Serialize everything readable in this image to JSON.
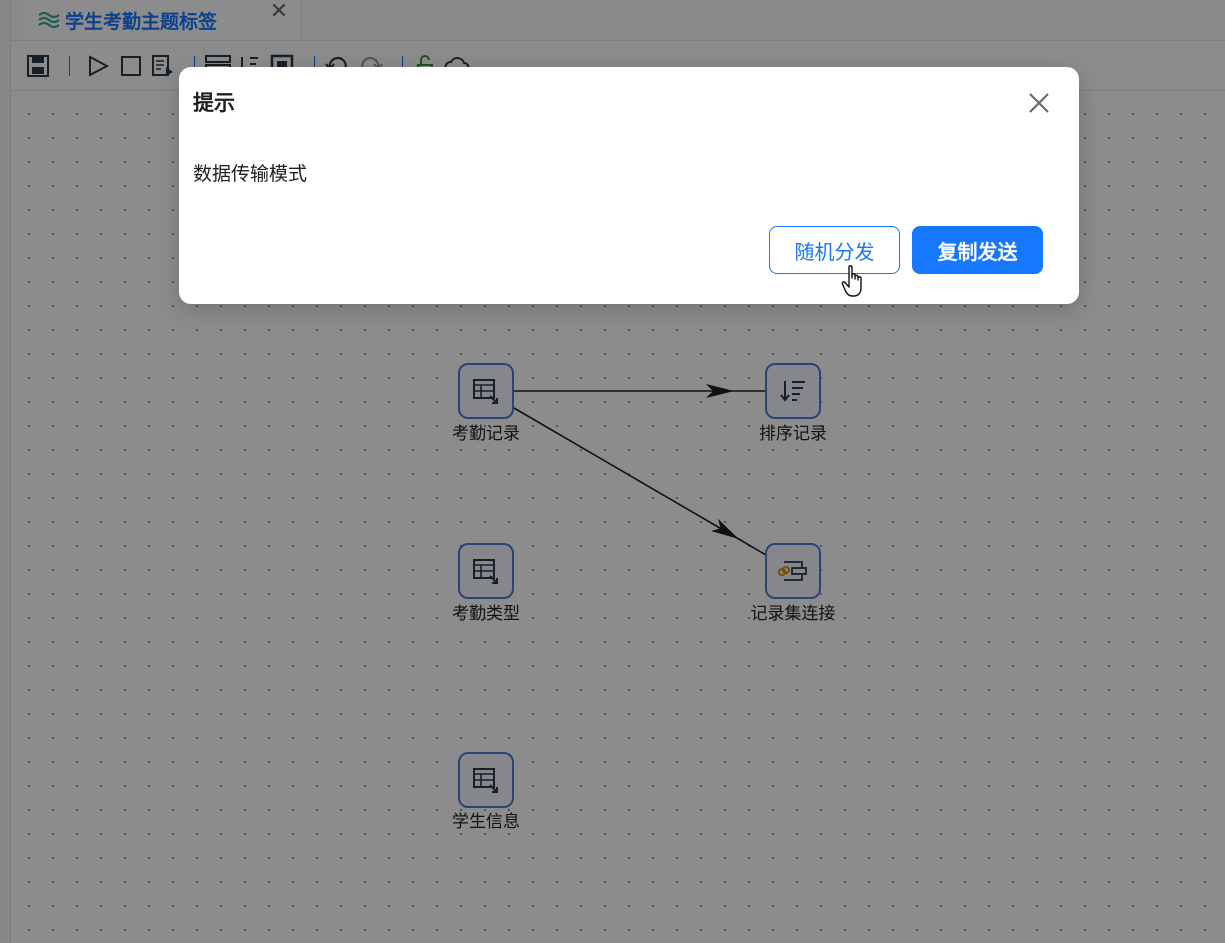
{
  "tab": {
    "title": "学生考勤主题标签",
    "close": "✕"
  },
  "toolbar": {
    "buttons": [
      "save-icon",
      "run-icon",
      "stop-icon",
      "preview-icon",
      "layout-icon",
      "align-icon",
      "grid-icon",
      "undo-icon",
      "redo-icon",
      "unlock-icon",
      "cloud-icon"
    ]
  },
  "nodes": [
    {
      "id": "attendance-records",
      "label": "考勤记录",
      "icon": "table-input-icon"
    },
    {
      "id": "sorted-records",
      "label": "排序记录",
      "icon": "sort-icon"
    },
    {
      "id": "attendance-types",
      "label": "考勤类型",
      "icon": "table-input-icon"
    },
    {
      "id": "record-join",
      "label": "记录集连接",
      "icon": "join-icon"
    },
    {
      "id": "student-info",
      "label": "学生信息",
      "icon": "table-input-icon"
    }
  ],
  "edges": [
    {
      "from": "attendance-records",
      "to": "sorted-records"
    },
    {
      "from": "attendance-records",
      "to": "record-join"
    }
  ],
  "dialog": {
    "title": "提示",
    "message": "数据传输模式",
    "buttons": {
      "random": "随机分发",
      "copy": "复制发送"
    }
  },
  "colors": {
    "primary": "#1677ff",
    "overlay": "rgba(0,0,0,0.45)",
    "node_border": "#4a7fd4"
  }
}
